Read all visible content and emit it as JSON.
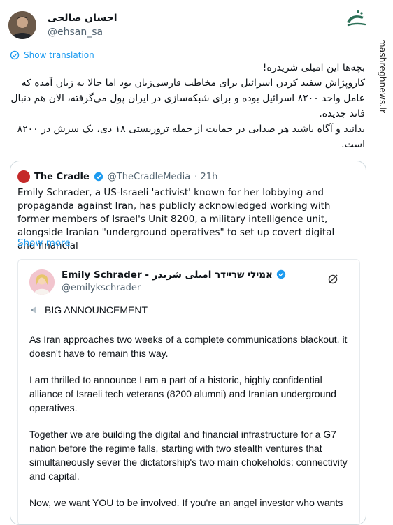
{
  "brand": {
    "logo_text": "مشرق",
    "watermark": "mashreghnews.ir"
  },
  "author": {
    "name": "احسان صالحی",
    "handle": "@ehsan_sa"
  },
  "translate_label": "Show translation",
  "tweet_lines": [
    "بچه‌ها این امیلی شریدره!",
    "کاروپژاش سفید کردن اسرائیل برای مخاطب فارسی‌زبان بود اما حالا به زبان آمده که عامل واحد ۸۲۰۰ اسرائیل بوده و برای شبکه‌سازی در ایران پول می‌گرفته، الان هم دنبال فاند جدیده.",
    "بدانید و آگاه باشید هر صدایی در حمایت از حمله تروریستی ۱۸ دی، یک سرش در ۸۲۰۰ است."
  ],
  "quote": {
    "name": "The Cradle",
    "handle": "@TheCradleMedia",
    "time": "· 21h",
    "text": "Emily Schrader, a US-Israeli 'activist' known for her lobbying and propaganda against Iran, has publicly acknowledged working with former members of Israel's Unit 8200, a military intelligence unit, alongside Iranian \"underground operatives\" to set up covert digital and financial",
    "show_more": "Show more"
  },
  "embedded": {
    "name": "Emily Schrader - אמילי שריידר امیلی شریدر",
    "handle": "@emilykschrader",
    "announcement": "BIG ANNOUNCEMENT",
    "paragraphs": [
      "As Iran approaches two weeks of a complete communications blackout, it doesn't have to remain this way.",
      "I am thrilled to announce I am a part of a historic, highly confidential alliance of Israeli tech veterans (8200 alumni) and Iranian underground operatives.",
      "Together we are building the digital and financial infrastructure for a G7 nation before the regime falls, starting with two stealth ventures that simultaneously sever the dictatorship's two main chokeholds: connectivity and capital.",
      "Now, we want YOU to be involved. If you're an angel investor who wants"
    ]
  },
  "colors": {
    "link": "#1d9bf0",
    "verified": "#1d9bf0",
    "secondary": "#536471"
  }
}
